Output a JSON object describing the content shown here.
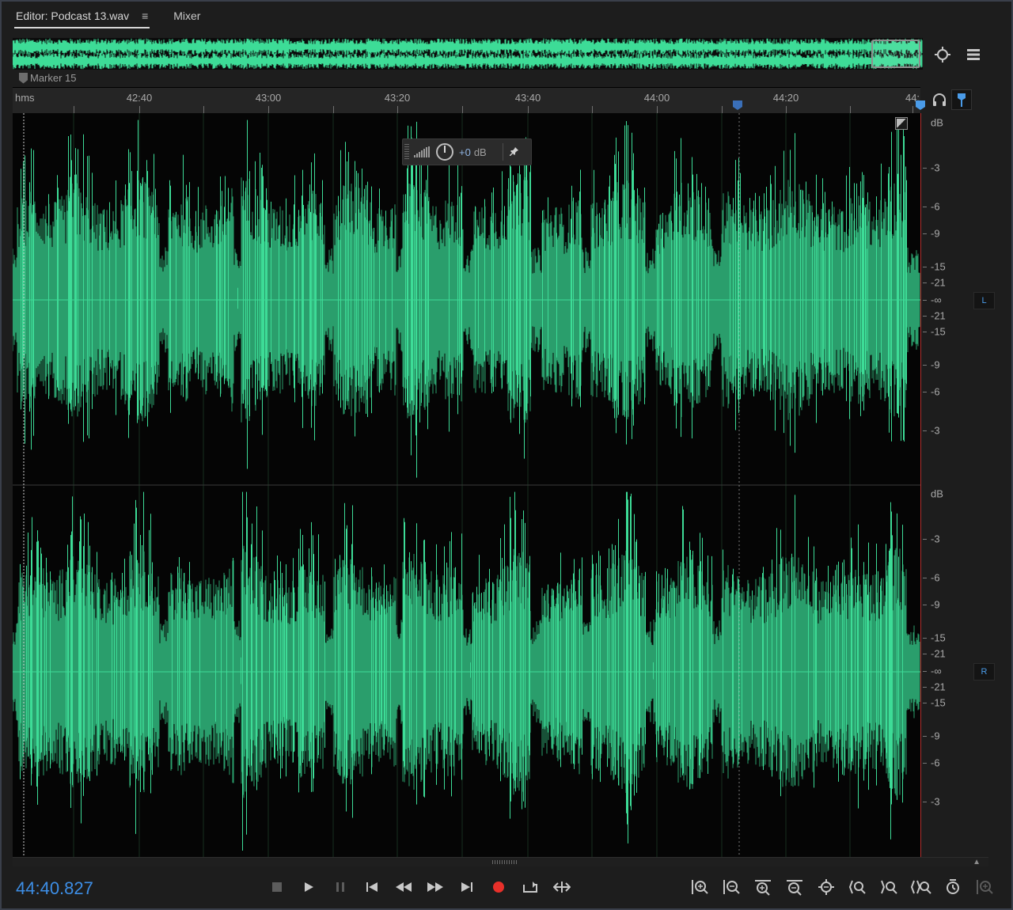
{
  "tabs": [
    {
      "label": "Editor: Podcast 13.wav",
      "active": true
    },
    {
      "label": "Mixer",
      "active": false
    }
  ],
  "tab_menu_icon": "hamburger-menu-icon",
  "marker": {
    "label": "Marker 15"
  },
  "ruler": {
    "unit": "hms",
    "ticks": [
      "42:40",
      "43:00",
      "43:20",
      "43:40",
      "44:00",
      "44:20",
      "44:"
    ]
  },
  "hud": {
    "value": "+0",
    "unit": "dB"
  },
  "db_scale": {
    "unit": "dB",
    "labels_left": [
      "dB",
      "-3",
      "-6",
      "-9",
      "-15",
      "-21",
      "-∞",
      "-21",
      "-15",
      "-9",
      "-6",
      "-3"
    ],
    "labels_right": [
      "dB",
      "-3",
      "-6",
      "-9",
      "-15",
      "-21",
      "-∞",
      "-21",
      "-15",
      "-9",
      "-6",
      "-3"
    ]
  },
  "channels": {
    "left": "L",
    "right": "R"
  },
  "timecode": "44:40.827",
  "transport": [
    {
      "name": "stop-button",
      "icon": "stop-icon",
      "enabled": false
    },
    {
      "name": "play-button",
      "icon": "play-icon",
      "enabled": true
    },
    {
      "name": "pause-button",
      "icon": "pause-icon",
      "enabled": false
    },
    {
      "name": "go-to-start-button",
      "icon": "skip-back-icon",
      "enabled": true
    },
    {
      "name": "rewind-button",
      "icon": "rewind-icon",
      "enabled": true
    },
    {
      "name": "fast-forward-button",
      "icon": "fast-forward-icon",
      "enabled": true
    },
    {
      "name": "go-to-end-button",
      "icon": "skip-forward-icon",
      "enabled": true
    },
    {
      "name": "record-button",
      "icon": "record-icon",
      "enabled": true
    },
    {
      "name": "loop-button",
      "icon": "loop-icon",
      "enabled": true
    },
    {
      "name": "skip-selection-button",
      "icon": "skip-selection-icon",
      "enabled": true
    }
  ],
  "zoom_tools": [
    "zoom-in-amplitude-icon",
    "zoom-out-amplitude-icon",
    "zoom-in-time-icon",
    "zoom-out-time-icon",
    "zoom-out-full-icon",
    "zoom-in-point-left-icon",
    "zoom-in-point-right-icon",
    "zoom-selection-icon",
    "zoom-reset-icon",
    "zoom-to-region-icon"
  ],
  "colors": {
    "waveform": "#3ddc97",
    "waveform_dark": "#2a9e6c",
    "accent": "#3d8ee6",
    "playhead": "#c33a36",
    "record": "#e8302a"
  }
}
